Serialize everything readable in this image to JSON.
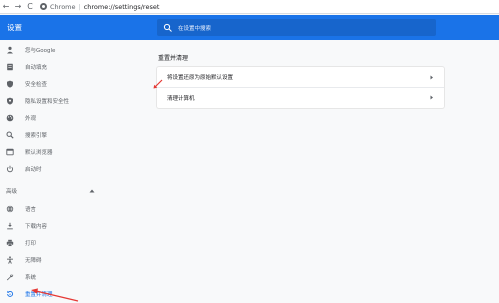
{
  "toolbar": {
    "back": "←",
    "forward": "→",
    "reload": "C",
    "chrome_label": "Chrome",
    "separator": "|",
    "url": "chrome://settings/reset"
  },
  "header": {
    "title": "设置",
    "search_placeholder": "在设置中搜索"
  },
  "sidebar": {
    "items": [
      {
        "label": "您与Google",
        "icon": "person-icon"
      },
      {
        "label": "自动填充",
        "icon": "autofill-icon"
      },
      {
        "label": "安全检查",
        "icon": "shield-icon"
      },
      {
        "label": "隐私设置和安全性",
        "icon": "privacy-shield-icon"
      },
      {
        "label": "外观",
        "icon": "palette-icon"
      },
      {
        "label": "搜索引擎",
        "icon": "search-icon"
      },
      {
        "label": "默认浏览器",
        "icon": "browser-icon"
      },
      {
        "label": "启动时",
        "icon": "power-icon"
      }
    ],
    "advanced_label": "高级",
    "advanced_items": [
      {
        "label": "语言",
        "icon": "globe-icon"
      },
      {
        "label": "下载内容",
        "icon": "download-icon"
      },
      {
        "label": "打印",
        "icon": "print-icon"
      },
      {
        "label": "无障碍",
        "icon": "accessibility-icon"
      },
      {
        "label": "系统",
        "icon": "wrench-icon"
      },
      {
        "label": "重置并清理",
        "icon": "reset-icon",
        "active": true
      }
    ]
  },
  "main": {
    "section_title": "重置并清理",
    "rows": [
      {
        "label": "将设置还原为原始默认设置"
      },
      {
        "label": "清理计算机"
      }
    ]
  },
  "colors": {
    "accent": "#1a73e8",
    "annotation": "#e53935"
  }
}
